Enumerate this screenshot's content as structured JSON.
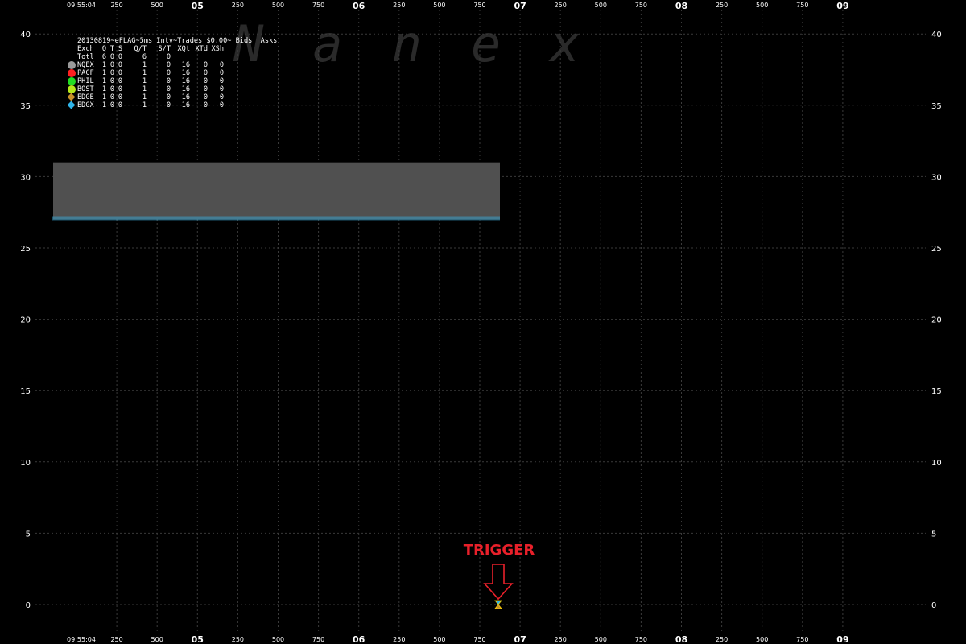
{
  "chart_data": {
    "type": "timeseries-quotes",
    "title": "20130819~eFLAG~5ms Intv~Trades $0.00~ Bids  Asks",
    "y_axis": {
      "range": [
        0,
        40
      ],
      "ticks": [
        "0",
        "5",
        "10",
        "15",
        "20",
        "25",
        "30",
        "35",
        "40"
      ]
    },
    "x_axis": {
      "labels": [
        "09:55:04",
        "250",
        "500",
        "05",
        "250",
        "500",
        "750",
        "06",
        "250",
        "500",
        "750",
        "07",
        "250",
        "500",
        "750",
        "08",
        "250",
        "500",
        "750",
        "09"
      ],
      "bold_labels": [
        "05",
        "06",
        "07",
        "08",
        "09"
      ]
    },
    "grid": true,
    "quote_band": {
      "ask": 31,
      "bid": 27,
      "time_start": "09:55:04.000",
      "time_end": "09:55:06.630"
    },
    "trade": {
      "price": 0,
      "time": "09:55:06.630"
    },
    "annotation": "TRIGGER",
    "watermark": "Nanex"
  },
  "legend": {
    "header": [
      "Exch",
      "Q",
      "T",
      "S",
      "Q/T",
      "S/T",
      "XQt",
      "XTd",
      "XSh"
    ],
    "total": [
      "Totl",
      "6",
      "0",
      "0",
      "6",
      "0",
      "",
      "",
      ""
    ],
    "rows": [
      {
        "name": "NQEX",
        "q": "1",
        "t": "0",
        "s": "0",
        "qt": "1",
        "st": "0",
        "xqt": "16",
        "xtd": "0",
        "xsh": "0",
        "color": "#9a9a9a",
        "shape": "circle"
      },
      {
        "name": "PACF",
        "q": "1",
        "t": "0",
        "s": "0",
        "qt": "1",
        "st": "0",
        "xqt": "16",
        "xtd": "0",
        "xsh": "0",
        "color": "#ff2020",
        "shape": "circle"
      },
      {
        "name": "PHIL",
        "q": "1",
        "t": "0",
        "s": "0",
        "qt": "1",
        "st": "0",
        "xqt": "16",
        "xtd": "0",
        "xsh": "0",
        "color": "#22dd22",
        "shape": "circle"
      },
      {
        "name": "BOST",
        "q": "1",
        "t": "0",
        "s": "0",
        "qt": "1",
        "st": "0",
        "xqt": "16",
        "xtd": "0",
        "xsh": "0",
        "color": "#b4e81a",
        "shape": "circle"
      },
      {
        "name": "EDGE",
        "q": "1",
        "t": "0",
        "s": "0",
        "qt": "1",
        "st": "0",
        "xqt": "16",
        "xtd": "0",
        "xsh": "0",
        "color": "#c8902a",
        "shape": "diamond"
      },
      {
        "name": "EDGX",
        "q": "1",
        "t": "0",
        "s": "0",
        "qt": "1",
        "st": "0",
        "xqt": "16",
        "xtd": "0",
        "xsh": "0",
        "color": "#2fb4e8",
        "shape": "diamond"
      }
    ]
  },
  "colors": {
    "background": "#000000",
    "grid": "#3a3a3a",
    "band": "#505050",
    "bid_line": "#39a9d6",
    "trigger": "#e8202a"
  }
}
